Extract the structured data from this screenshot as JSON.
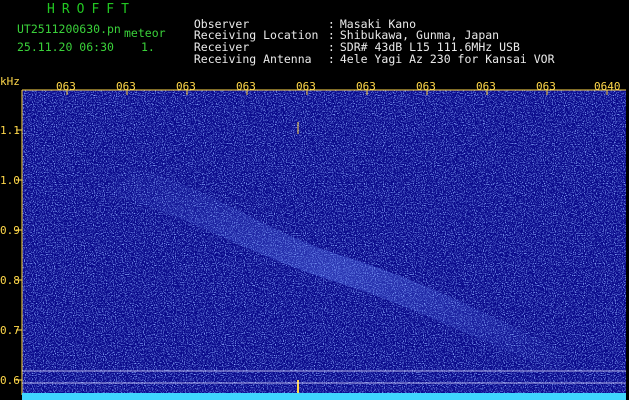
{
  "header": {
    "brand": "HROFFT",
    "filename": "UT2511200630.pn",
    "meteor_label": "meteor",
    "datetime": "25.11.20 06:30",
    "index": "1.",
    "info": [
      {
        "key": "Observer",
        "value": "Masaki Kano"
      },
      {
        "key": "Receiving Location",
        "value": "Shibukawa, Gunma, Japan"
      },
      {
        "key": "Receiver",
        "value": "SDR# 43dB L15 111.6MHz USB"
      },
      {
        "key": "Receiving Antenna",
        "value": "4ele Yagi Az 230 for Kansai VOR"
      }
    ]
  },
  "waterfall": {
    "y_unit": "kHz",
    "y_ticks": [
      "1.1",
      "1.0",
      "0.9",
      "0.8",
      "0.7",
      "0.6"
    ],
    "x_ticks": [
      "063",
      "063",
      "063",
      "063",
      "063",
      "063",
      "063",
      "063",
      "063",
      "0640"
    ],
    "colors": {
      "background": "#0a0a8c",
      "speckle": "#3a6cff",
      "highlight": "#cfe3ff",
      "grid_yellow": "#ffd84a",
      "baseline_cyan": "#3fd6ff"
    }
  }
}
